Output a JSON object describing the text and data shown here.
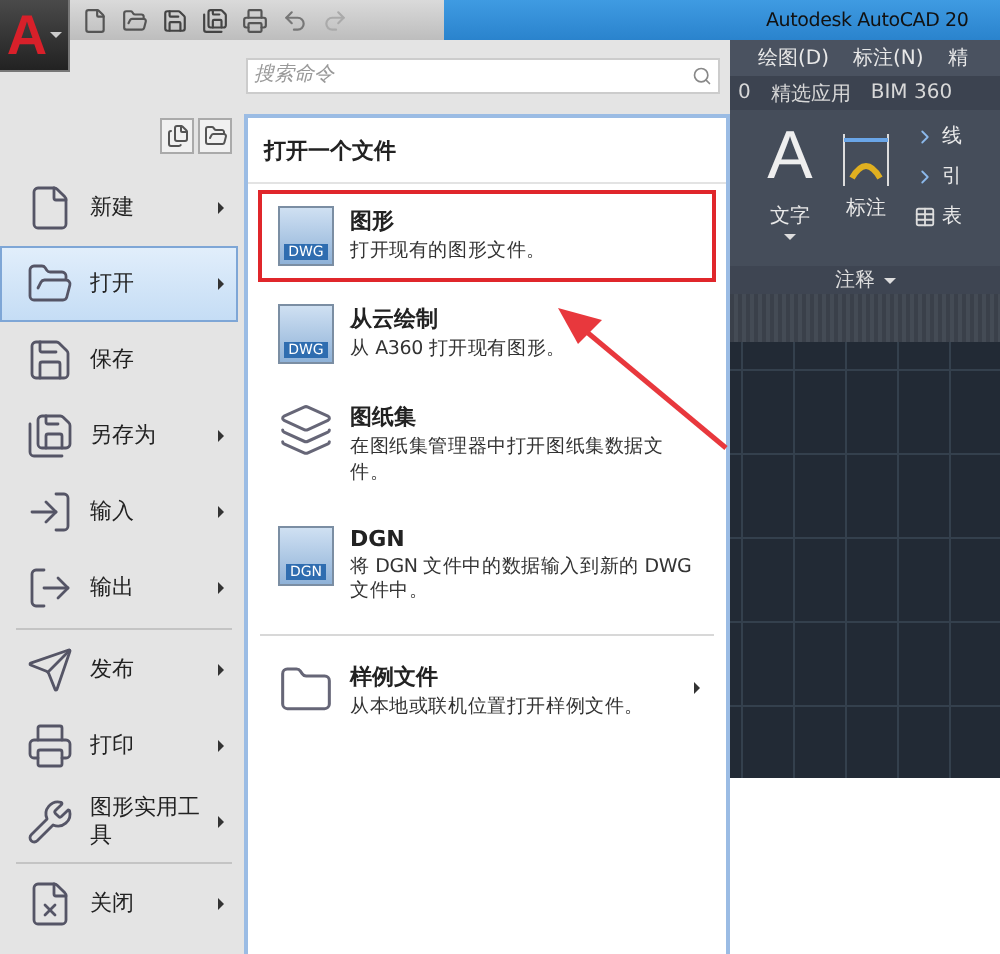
{
  "logo": {
    "letter": "A"
  },
  "title_bar": {
    "title": "Autodesk AutoCAD 20"
  },
  "search": {
    "placeholder": "搜索命令"
  },
  "ribbon": {
    "menus": [
      "绘图(D)",
      "标注(N)",
      "精"
    ],
    "tabs": [
      "0",
      "精选应用",
      "BIM 360"
    ],
    "big_tools": [
      {
        "glyph": "A",
        "label": "文字",
        "dropdown": true
      },
      {
        "label": "标注",
        "dropdown": false
      }
    ],
    "small_tools": [
      "线",
      "引",
      "表"
    ],
    "panel_title": "注释"
  },
  "app_menu": {
    "items": [
      {
        "label": "新建",
        "submenu": true,
        "selected": false,
        "separator_before": false
      },
      {
        "label": "打开",
        "submenu": true,
        "selected": true,
        "separator_before": false
      },
      {
        "label": "保存",
        "submenu": false,
        "selected": false,
        "separator_before": false
      },
      {
        "label": "另存为",
        "submenu": true,
        "selected": false,
        "separator_before": false
      },
      {
        "label": "输入",
        "submenu": true,
        "selected": false,
        "separator_before": false
      },
      {
        "label": "输出",
        "submenu": true,
        "selected": false,
        "separator_before": false
      },
      {
        "label": "发布",
        "submenu": true,
        "selected": false,
        "separator_before": true
      },
      {
        "label": "打印",
        "submenu": true,
        "selected": false,
        "separator_before": false
      },
      {
        "label": "图形实用工具",
        "submenu": true,
        "selected": false,
        "separator_before": false
      },
      {
        "label": "关闭",
        "submenu": true,
        "selected": false,
        "separator_before": true
      }
    ]
  },
  "open_panel": {
    "title": "打开一个文件",
    "items": [
      {
        "title": "图形",
        "description": "打开现有的图形文件。",
        "icon_label": "DWG",
        "highlighted": true,
        "submenu": false,
        "separator_before": false
      },
      {
        "title": "从云绘制",
        "description": "从 A360 打开现有图形。",
        "icon_label": "DWG",
        "highlighted": false,
        "submenu": false,
        "separator_before": false
      },
      {
        "title": "图纸集",
        "description": "在图纸集管理器中打开图纸集数据文件。",
        "highlighted": false,
        "submenu": false,
        "separator_before": false
      },
      {
        "title": "DGN",
        "description": "将 DGN 文件中的数据输入到新的 DWG 文件中。",
        "icon_label": "DGN",
        "highlighted": false,
        "submenu": false,
        "separator_before": false
      },
      {
        "title": "样例文件",
        "description": "从本地或联机位置打开样例文件。",
        "highlighted": false,
        "submenu": true,
        "separator_before": true
      }
    ]
  }
}
